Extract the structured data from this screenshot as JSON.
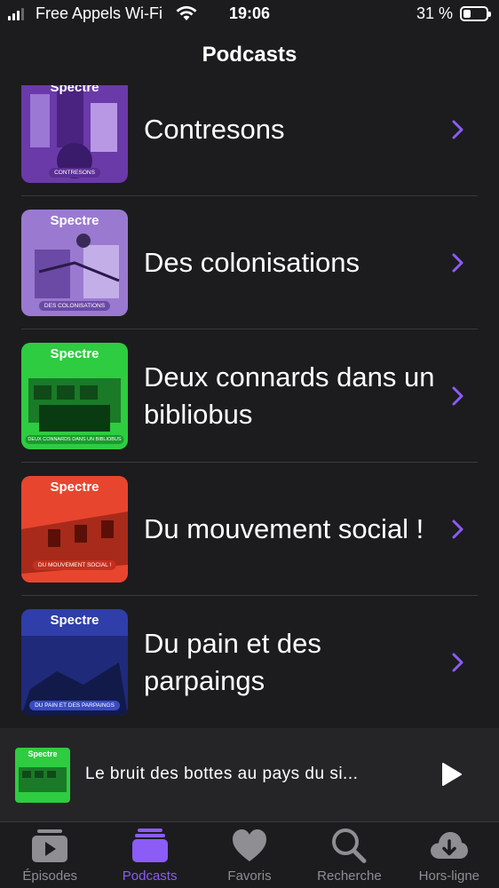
{
  "status": {
    "carrier": "Free Appels Wi-Fi",
    "time": "19:06",
    "battery": "31 %"
  },
  "nav": {
    "title": "Podcasts"
  },
  "accent": "#8b5cf6",
  "podcasts": [
    {
      "title": "Contresons",
      "brand": "Spectre",
      "caption": "CONTRESONS",
      "color": "#7b4bb8"
    },
    {
      "title": "Des colonisations",
      "brand": "Spectre",
      "caption": "DES COLONISATIONS",
      "color": "#8b6bc4"
    },
    {
      "title": "Deux connards dans un bibliobus",
      "brand": "Spectre",
      "caption": "DEUX CONNARDS DANS UN BIBLIOBUS",
      "color": "#2ecc40"
    },
    {
      "title": "Du mouvement social !",
      "brand": "Spectre",
      "caption": "DU MOUVEMENT SOCIAL !",
      "color": "#e8452f"
    },
    {
      "title": "Du pain et des parpaings",
      "brand": "Spectre",
      "caption": "DU PAIN ET DES PARPAINGS",
      "color": "#2f3ea8"
    }
  ],
  "player": {
    "title": "Le bruit des bottes au pays du si...",
    "brand": "Spectre"
  },
  "tabs": [
    {
      "label": "Épisodes",
      "icon": "episodes-icon"
    },
    {
      "label": "Podcasts",
      "icon": "podcasts-icon",
      "active": true
    },
    {
      "label": "Favoris",
      "icon": "heart-icon"
    },
    {
      "label": "Recherche",
      "icon": "search-icon"
    },
    {
      "label": "Hors-ligne",
      "icon": "download-cloud-icon"
    }
  ]
}
